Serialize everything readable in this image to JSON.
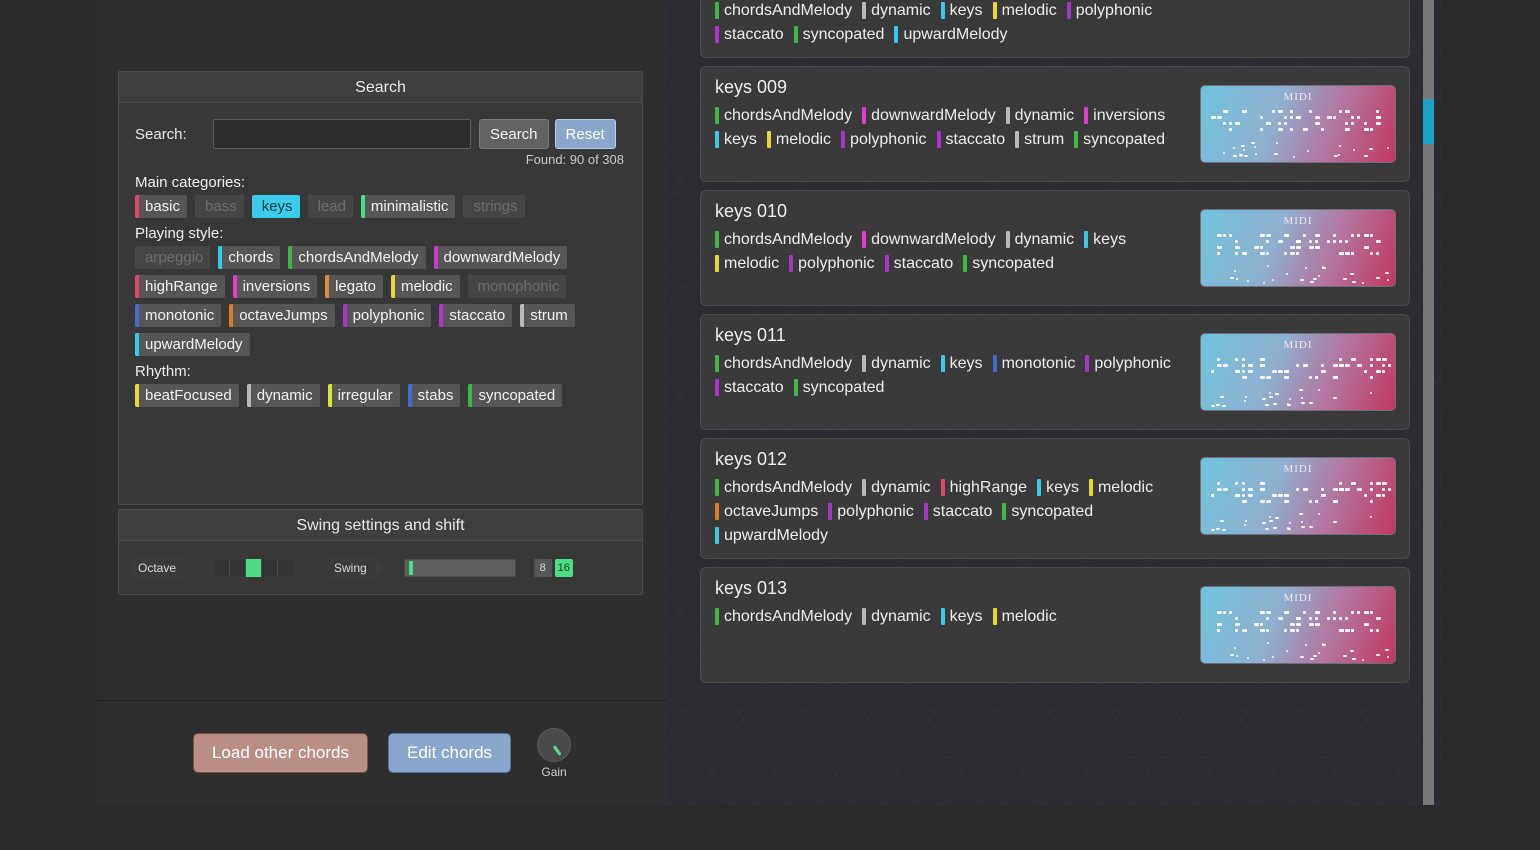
{
  "search_panel": {
    "title": "Search",
    "search_label": "Search:",
    "search_value": "",
    "search_placeholder": "",
    "search_button": "Search",
    "reset_button": "Reset",
    "found_text": "Found: 90 of 308",
    "main_categories_label": "Main categories:",
    "main_categories": [
      {
        "label": "basic",
        "color": "#e0486b",
        "state": "on"
      },
      {
        "label": "bass",
        "color": "#777777",
        "state": "off"
      },
      {
        "label": "keys",
        "color": "#39cdea",
        "state": "selected"
      },
      {
        "label": "lead",
        "color": "#777777",
        "state": "off"
      },
      {
        "label": "minimalistic",
        "color": "#4ddc86",
        "state": "on"
      },
      {
        "label": "strings",
        "color": "#777777",
        "state": "off"
      }
    ],
    "playing_style_label": "Playing style:",
    "playing_style": [
      {
        "label": "arpeggio",
        "color": "#888888",
        "state": "off"
      },
      {
        "label": "chords",
        "color": "#3bc9e8",
        "state": "on"
      },
      {
        "label": "chordsAndMelody",
        "color": "#3fb54a",
        "state": "on"
      },
      {
        "label": "downwardMelody",
        "color": "#c040cc",
        "state": "on"
      },
      {
        "label": "highRange",
        "color": "#e0486b",
        "state": "on"
      },
      {
        "label": "inversions",
        "color": "#e13fc9",
        "state": "on"
      },
      {
        "label": "legato",
        "color": "#e08a3c",
        "state": "on"
      },
      {
        "label": "melodic",
        "color": "#e8d832",
        "state": "on"
      },
      {
        "label": "monophonic",
        "color": "#888888",
        "state": "off"
      },
      {
        "label": "monotonic",
        "color": "#4668d0",
        "state": "on"
      },
      {
        "label": "octaveJumps",
        "color": "#e07b22",
        "state": "on"
      },
      {
        "label": "polyphonic",
        "color": "#a238c4",
        "state": "on"
      },
      {
        "label": "staccato",
        "color": "#b132cf",
        "state": "on"
      },
      {
        "label": "strum",
        "color": "#b8b8b8",
        "state": "on"
      },
      {
        "label": "upwardMelody",
        "color": "#3bc9e8",
        "state": "on"
      }
    ],
    "rhythm_label": "Rhythm:",
    "rhythm": [
      {
        "label": "beatFocused",
        "color": "#e8d832",
        "state": "on"
      },
      {
        "label": "dynamic",
        "color": "#b8b8b8",
        "state": "on"
      },
      {
        "label": "irregular",
        "color": "#d4e832",
        "state": "on"
      },
      {
        "label": "stabs",
        "color": "#4668d0",
        "state": "on"
      },
      {
        "label": "syncopated",
        "color": "#3fb54a",
        "state": "on"
      }
    ]
  },
  "swing_panel": {
    "title": "Swing settings and shift",
    "octave_label": "Octave",
    "octave_cells": 5,
    "octave_active_index": 2,
    "swing_label": "Swing",
    "swing_value_percent": 3,
    "note_buttons": [
      {
        "label": "8",
        "active": false
      },
      {
        "label": "16",
        "active": true
      }
    ]
  },
  "bottom_bar": {
    "load_button": "Load other chords",
    "edit_button": "Edit chords",
    "gain_label": "Gain"
  },
  "preset_list": {
    "scroll_position_percent": 13,
    "items": [
      {
        "title": "",
        "partial": true,
        "tags": [
          {
            "label": "chordsAndMelody",
            "color": "#3fb54a"
          },
          {
            "label": "dynamic",
            "color": "#b8b8b8"
          },
          {
            "label": "keys",
            "color": "#3bc9e8"
          },
          {
            "label": "melodic",
            "color": "#e8d832"
          },
          {
            "label": "polyphonic",
            "color": "#a238c4"
          },
          {
            "label": "staccato",
            "color": "#b132cf"
          },
          {
            "label": "syncopated",
            "color": "#3fb54a"
          },
          {
            "label": "upwardMelody",
            "color": "#3bc9e8"
          }
        ],
        "thumb_label": "MIDI",
        "thumb_style": "dense"
      },
      {
        "title": "keys 009",
        "partial": false,
        "tags": [
          {
            "label": "chordsAndMelody",
            "color": "#3fb54a"
          },
          {
            "label": "downwardMelody",
            "color": "#e13fc9"
          },
          {
            "label": "dynamic",
            "color": "#b8b8b8"
          },
          {
            "label": "inversions",
            "color": "#e13fc9"
          },
          {
            "label": "keys",
            "color": "#3bc9e8"
          },
          {
            "label": "melodic",
            "color": "#e8d832"
          },
          {
            "label": "polyphonic",
            "color": "#a238c4"
          },
          {
            "label": "staccato",
            "color": "#b132cf"
          },
          {
            "label": "strum",
            "color": "#b8b8b8"
          },
          {
            "label": "syncopated",
            "color": "#3fb54a"
          }
        ],
        "thumb_label": "MIDI",
        "thumb_style": "sustained"
      },
      {
        "title": "keys 010",
        "partial": false,
        "tags": [
          {
            "label": "chordsAndMelody",
            "color": "#3fb54a"
          },
          {
            "label": "downwardMelody",
            "color": "#e13fc9"
          },
          {
            "label": "dynamic",
            "color": "#b8b8b8"
          },
          {
            "label": "keys",
            "color": "#3bc9e8"
          },
          {
            "label": "melodic",
            "color": "#e8d832"
          },
          {
            "label": "polyphonic",
            "color": "#a238c4"
          },
          {
            "label": "staccato",
            "color": "#b132cf"
          },
          {
            "label": "syncopated",
            "color": "#3fb54a"
          }
        ],
        "thumb_label": "MIDI",
        "thumb_style": "spread"
      },
      {
        "title": "keys 011",
        "partial": false,
        "tags": [
          {
            "label": "chordsAndMelody",
            "color": "#3fb54a"
          },
          {
            "label": "dynamic",
            "color": "#b8b8b8"
          },
          {
            "label": "keys",
            "color": "#3bc9e8"
          },
          {
            "label": "monotonic",
            "color": "#4668d0"
          },
          {
            "label": "polyphonic",
            "color": "#a238c4"
          },
          {
            "label": "staccato",
            "color": "#b132cf"
          },
          {
            "label": "syncopated",
            "color": "#3fb54a"
          }
        ],
        "thumb_label": "MIDI",
        "thumb_style": "dense"
      },
      {
        "title": "keys 012",
        "partial": false,
        "tags": [
          {
            "label": "chordsAndMelody",
            "color": "#3fb54a"
          },
          {
            "label": "dynamic",
            "color": "#b8b8b8"
          },
          {
            "label": "highRange",
            "color": "#e0486b"
          },
          {
            "label": "keys",
            "color": "#3bc9e8"
          },
          {
            "label": "melodic",
            "color": "#e8d832"
          },
          {
            "label": "octaveJumps",
            "color": "#e07b22"
          },
          {
            "label": "polyphonic",
            "color": "#a238c4"
          },
          {
            "label": "staccato",
            "color": "#b132cf"
          },
          {
            "label": "syncopated",
            "color": "#3fb54a"
          },
          {
            "label": "upwardMelody",
            "color": "#3bc9e8"
          }
        ],
        "thumb_label": "MIDI",
        "thumb_style": "dense"
      },
      {
        "title": "keys 013",
        "partial": false,
        "tags": [
          {
            "label": "chordsAndMelody",
            "color": "#3fb54a"
          },
          {
            "label": "dynamic",
            "color": "#b8b8b8"
          },
          {
            "label": "keys",
            "color": "#3bc9e8"
          },
          {
            "label": "melodic",
            "color": "#e8d832"
          }
        ],
        "thumb_label": "MIDI",
        "thumb_style": "spread"
      }
    ]
  }
}
